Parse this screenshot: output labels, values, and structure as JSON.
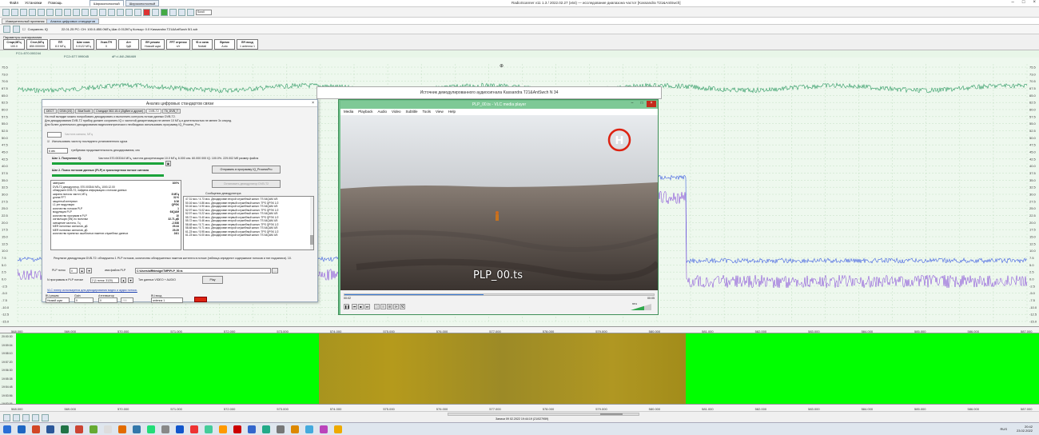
{
  "titlebar": {
    "menu": [
      "Файл",
      "Установки",
      "Помощь"
    ],
    "tabs": [
      "Широкополосный",
      "Широкополосный"
    ],
    "app_title": "RadioScanner v11 1.3 / 2022.02.27 (x64) — исследование диапазона частот [Kassandra T21&AntSwch]"
  },
  "toolbar": {
    "select_value": "Scroll"
  },
  "tabs2": {
    "tab1": "Измерительный приемник",
    "tab2": "Анализ цифровых стандартов"
  },
  "infoline": {
    "checkbox_label": "Сохранить IQ",
    "text": "22.01.25 РС: СН: 100.0-850.0МГц Шаг-0.012КГц Кольцо: 0.0 Kassandra T21&AntSwch 5/1.sdr"
  },
  "params": {
    "label": "Параметры сканирования",
    "boxes": [
      {
        "title": "Старт,МГц",
        "value": "100.0"
      },
      {
        "title": "Стоп,МГц",
        "value": "850.000000"
      },
      {
        "title": "ПП",
        "value": "8.0 МГц"
      },
      {
        "title": "Шаг скан.",
        "value": "0.0122 МГц"
      },
      {
        "title": "Усил.ПЧ",
        "value": "0"
      },
      {
        "title": "Атт",
        "value": "0дБ"
      },
      {
        "title": "ВЧ режим",
        "value": "Низкий шум"
      },
      {
        "title": "FFT отрезок",
        "value": "н/т"
      },
      {
        "title": "Ф-я окна",
        "value": "Nuttall"
      },
      {
        "title": "Время",
        "value": "Auto"
      },
      {
        "title": "ВЧ вход",
        "value": "1 antenna 1"
      }
    ]
  },
  "markers": {
    "m1": "FC1=570.000244",
    "m2": "FC2=577.999045",
    "m3": "dF=(-84)-266469"
  },
  "spectrum": {
    "y_ticks": [
      "75.5",
      "73.0",
      "70.5",
      "67.5",
      "65.0",
      "62.5",
      "60.0",
      "57.5",
      "55.0",
      "52.5",
      "50.0",
      "47.5",
      "45.0",
      "42.5",
      "40.0",
      "37.5",
      "35.0",
      "32.5",
      "30.0",
      "27.5",
      "25.0",
      "22.5",
      "20.0",
      "17.5",
      "15.0",
      "12.5",
      "10.0",
      "7.5",
      "5.0",
      "2.5",
      "0.0",
      "-2.5",
      "-5.0",
      "-7.5",
      "-10.0",
      "-12.5",
      "-15.0"
    ],
    "x_ticks": [
      "568.000",
      "569.000",
      "570.000",
      "571.000",
      "572.000",
      "573.000",
      "574.000",
      "575.000",
      "576.000",
      "577.000",
      "578.000",
      "579.000",
      "580.000",
      "581.000",
      "582.000",
      "583.000",
      "584.000",
      "585.000",
      "586.000",
      "587.000"
    ],
    "colors": {
      "trace_green": "#2e9a63",
      "trace_purple": "#7b3ad6",
      "trace_blue": "#3f5fe0",
      "grid": "#b9d9b9",
      "bg": "#eef8ee"
    }
  },
  "waterfall": {
    "y_ticks": [
      "20:00:30",
      "19:59:04",
      "19:58:10",
      "19:57:20",
      "19:56:30",
      "19:55:38",
      "19:54:48",
      "19:53:56",
      "19:53:06"
    ],
    "colors": {
      "bg": "#00ff00",
      "band": "#a28c1a"
    }
  },
  "bottom": {
    "status": "Записи 09 02.2022 19:44:19 (21/027959)"
  },
  "taskbar": {
    "time": "20:42",
    "date": "23.02.2022",
    "lang": "RUS"
  },
  "dialog": {
    "title": "Анализ цифровых стандартов связи",
    "tabs": [
      "DECT",
      "GSM (2G)",
      "BlueTooth",
      "Стандарт 802.15.4 (ZigBee и другие)",
      "DVB-T2",
      "Tb_DVB_T"
    ],
    "line1": "На этой вкладке можно попробовать декодировать и выполнить контроль потоки данных DVB-T2.",
    "line2": "Для декодирования DVB-T2 прибор должен сохранить IQ с частотой дискретизации не менее 10 МГц и длительностью не менее 3х секунд.",
    "line3": "Для более длительного декодирования видеоэлектрического необходимо использовать программу IQ_Process_Pro.",
    "freq_label": "Частота канала, МГц",
    "use_last_freq": "Использовать частоту последнего установленного курса",
    "duration_value": "6 сек",
    "duration_label": "требуемая продолжительность декодирования, сек",
    "step1": "Шаг 1. Получение IQ.",
    "step1_info": "Частота 570.003344 МГц, частота дискретизации 10.0 МГц, 6.000 сек.    60.000 000 IQ.   100.0%.  229.002 Мб размер файла",
    "step2": "Шаг 2. Поиск потоков данных (PLP) в транспортном потоке сигнала",
    "btn_send": "Отправить в программу IQ_ProcessPro",
    "btn_stop": "Остановить демодулятор DVB-T2",
    "msgs_label": "Сообщения демодулятора",
    "status_rows": [
      {
        "k": "завершен",
        "v": "100%"
      },
      {
        "k": "DVB-T2 демодулятор, 570.003344 МГц, 1000.12.00",
        "v": ""
      },
      {
        "k": "обнаружен DVB-T2, найдена информация о потоках данных",
        "v": ""
      },
      {
        "k": "ширина полосы частот, МГц",
        "v": "8 МГц"
      },
      {
        "k": "длина FFT",
        "v": "32 K"
      },
      {
        "k": "защитный интервал",
        "v": "1/16"
      },
      {
        "k": "L1 pre модуляция",
        "v": "QPSK"
      },
      {
        "k": "количество потоков PLP",
        "v": "1"
      },
      {
        "k": "модуляция PLP",
        "v": "64QAM"
      },
      {
        "k": "количество программ в PLP",
        "v": "10"
      },
      {
        "k": "сигнал/шум (SN) по пилотам",
        "v": "32.71 дБ"
      },
      {
        "k": "смещение частоты, Гц",
        "v": "-2.538"
      },
      {
        "k": "MER пилотных сигналов, дБ",
        "v": "29.44"
      },
      {
        "k": "MER полезных сигналов, дБ",
        "v": "29.29"
      },
      {
        "k": "количество принятых ошибочных пакетов служебных данных",
        "v": "24/1"
      }
    ],
    "msg_rows": [
      "47.31 мсс / 4.73 мсс. Декодирован второй служебный канал: TS 64QAM 4/5",
      "50.16 мсс / 4.86 мсс. Декодирован первый служебный канал: TPS QPSK 1/2",
      "50.16 мсс / 4.90 мсс. Декодирован второй служебный канал: TS 64QAM 4/5",
      "52.97 мсс / 5.02 мсс. Декодирован первый служебный канал: TPS QPSK 1/2",
      "52.97 мсс / 5.22 мсс. Декодирован второй служебный канал: TS 64QAM 4/5",
      "55.72 мсс / 5.40 мсс. Декодирован первый служебный канал: TPS QPSK 1/2",
      "55.72 мсс / 5.46 мсс. Декодирован второй служебный канал: TS 64QAM 4/5",
      "58.48 мсс / 5.71 мсс. Декодирован первый служебный канал: TPS QPSK 1/2",
      "58.48 мсс / 5.71 мсс. Декодирован второй служебный канал: TS 64QAM 4/5",
      "61.23 мсс / 5.95 мсс. Декодирован первый служебный канал: TPS QPSK 1/2",
      "61.23 мсс / 6.00 мсс. Декодирован второй служебный канал: TS 64QAM 4/5"
    ],
    "result_line": "Результат демодуляции DVB-T2: обнаружено 1 PLP потоков, количество обнаруженных пакетов контента в потоке (таблица определит содержимое потоков и тип подзаписи). 10.",
    "plp_label": "PLP поток",
    "plp_value": "0",
    "file_label": "имя файла PLP",
    "file_value": "C:\\Users\\alRfdesign\\TMP\\PLP_00.ts",
    "program_label": "N программы в PLP потоке",
    "program_value": "2 (1 поток: 3120)",
    "type_label": "Тип данных VIDEO + AUDIO",
    "play": "Play",
    "vlc_note": "VLC плеер   используется для декодирования видео и аудио потока.",
    "hf_label": "ВЧ режим",
    "hf_value": "Низкий шум",
    "gain_label": "Gain",
    "gain_value": "0",
    "att_label": "Аттенюатор",
    "att_value": "0",
    "att2_value": "255",
    "input_label": "ВЧ вход",
    "input_value": "antenna 1"
  },
  "audio_header": {
    "title": "Источник демодулированного аудиосигнала Kassandra T21&AntSwch N 34"
  },
  "vlc": {
    "title": "PLP_00.ts - VLC media player",
    "menu": [
      "Media",
      "Playback",
      "Audio",
      "Video",
      "Subtitle",
      "Tools",
      "View",
      "Help"
    ],
    "overlay": "PLP_00.ts",
    "time_start": "00:02",
    "time_end": "00:05",
    "progress": 0.45,
    "volume": "65%"
  }
}
